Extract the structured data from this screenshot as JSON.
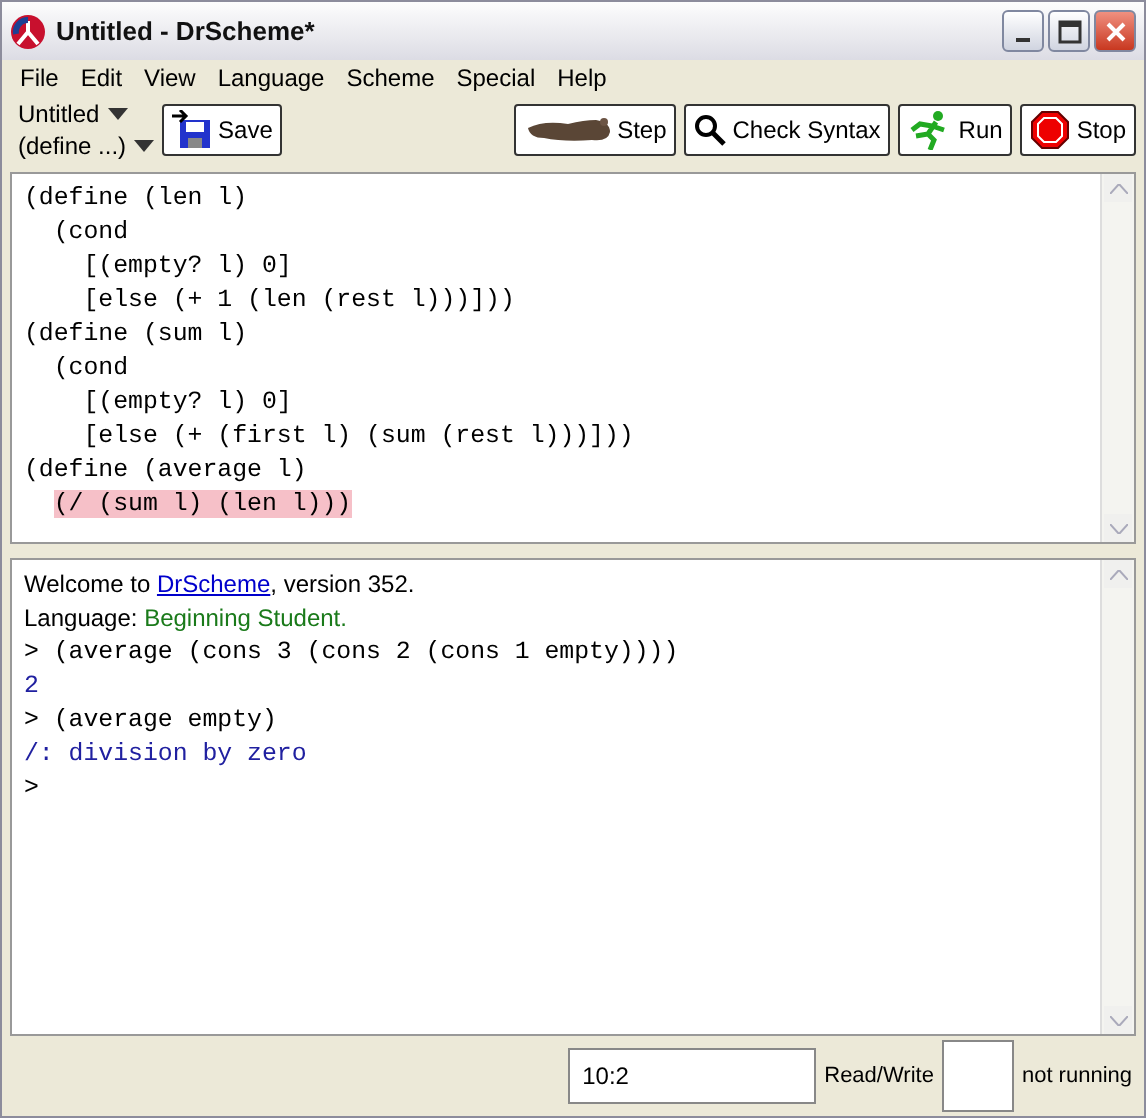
{
  "window": {
    "title": "Untitled - DrScheme*"
  },
  "menu": [
    "File",
    "Edit",
    "View",
    "Language",
    "Scheme",
    "Special",
    "Help"
  ],
  "toolbar": {
    "file_menu": "Untitled",
    "define_menu": "(define ...)",
    "buttons": [
      {
        "kind": "save",
        "label": "Save"
      },
      {
        "kind": "step",
        "label": "Step"
      },
      {
        "kind": "check",
        "label": "Check Syntax"
      },
      {
        "kind": "run",
        "label": "Run"
      },
      {
        "kind": "stop",
        "label": "Stop"
      }
    ]
  },
  "definitions": [
    {
      "text": "(define (len l)",
      "highlighted": false
    },
    {
      "text": "  (cond",
      "highlighted": false
    },
    {
      "text": "    [(empty? l) 0]",
      "highlighted": false
    },
    {
      "text": "    [else (+ 1 (len (rest l)))]))",
      "highlighted": false
    },
    {
      "text": "(define (sum l)",
      "highlighted": false
    },
    {
      "text": "  (cond",
      "highlighted": false
    },
    {
      "text": "    [(empty? l) 0]",
      "highlighted": false
    },
    {
      "text": "    [else (+ (first l) (sum (rest l)))]))",
      "highlighted": false
    },
    {
      "text": "(define (average l)",
      "highlighted": false
    },
    {
      "text": "  (/ (sum l) (len l)))",
      "highlighted": true
    }
  ],
  "interactions": [
    {
      "kind": "welcome",
      "before": "Welcome to ",
      "link": "DrScheme",
      "after": ", version 352."
    },
    {
      "kind": "language",
      "label": "Language: ",
      "value": "Beginning Student."
    },
    {
      "kind": "input",
      "prompt": ">",
      "text": "(average (cons 3 (cons 2 (cons 1 empty))))"
    },
    {
      "kind": "output",
      "text": "2"
    },
    {
      "kind": "input",
      "prompt": ">",
      "text": "(average empty)"
    },
    {
      "kind": "error",
      "text": "/: division by zero"
    },
    {
      "kind": "prompt",
      "prompt": ">"
    }
  ],
  "status_bar": {
    "position": "10:2",
    "mode": "Read/Write",
    "state": "not running"
  }
}
